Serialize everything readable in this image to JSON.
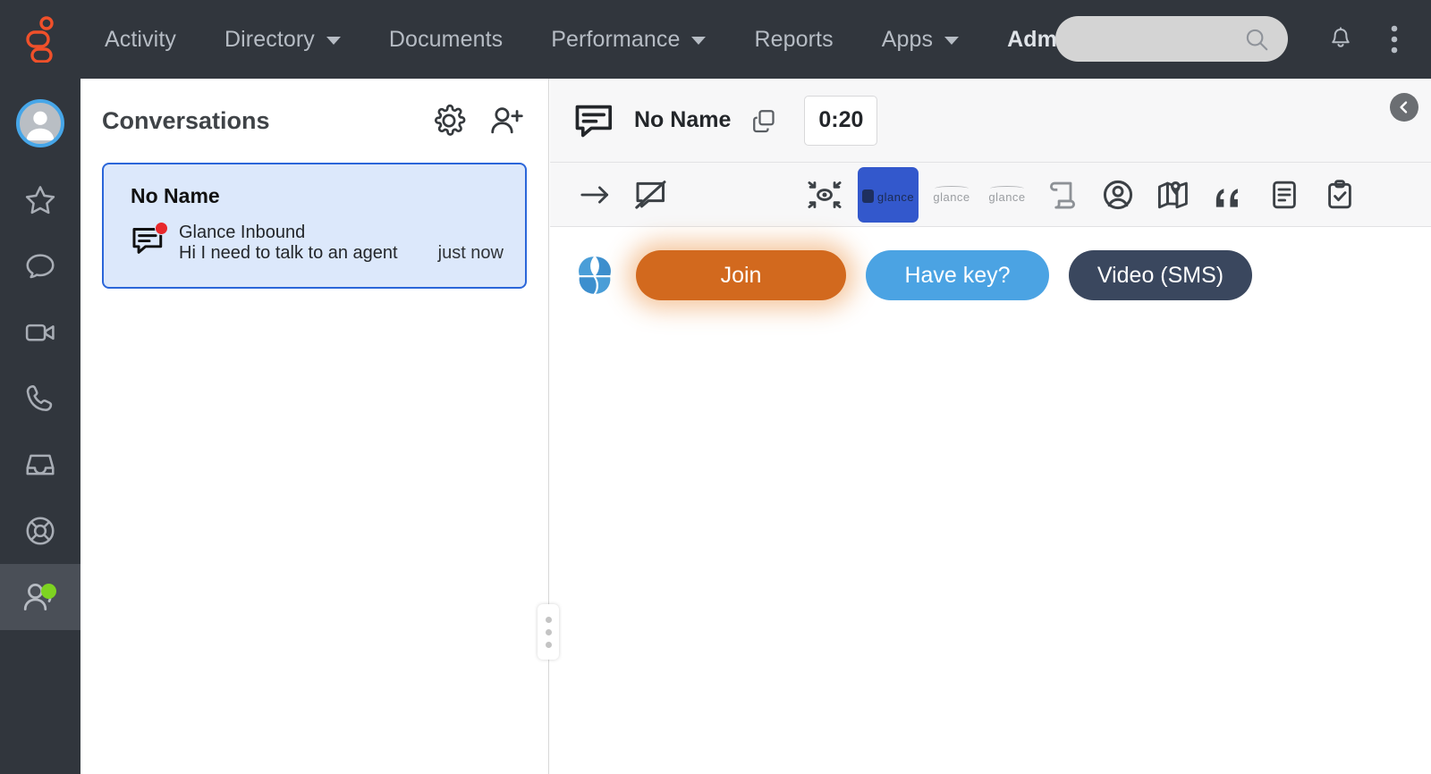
{
  "brand": {
    "logo_name": "glance-logo",
    "accent": "#f0502a"
  },
  "topnav": {
    "items": [
      {
        "label": "Activity",
        "has_caret": false
      },
      {
        "label": "Directory",
        "has_caret": true
      },
      {
        "label": "Documents",
        "has_caret": false
      },
      {
        "label": "Performance",
        "has_caret": true
      },
      {
        "label": "Reports",
        "has_caret": false
      },
      {
        "label": "Apps",
        "has_caret": true
      },
      {
        "label": "Admi",
        "has_caret": false
      }
    ],
    "search": {
      "value": "",
      "placeholder": ""
    },
    "bell_icon": "notification-bell-icon",
    "kebab_icon": "more-vertical-icon",
    "background": "#31363d"
  },
  "rail": {
    "items": [
      {
        "icon": "avatar-icon",
        "active": false
      },
      {
        "icon": "star-icon",
        "active": false
      },
      {
        "icon": "chat-bubble-icon",
        "active": false
      },
      {
        "icon": "video-camera-icon",
        "active": false
      },
      {
        "icon": "phone-icon",
        "active": false
      },
      {
        "icon": "inbox-tray-icon",
        "active": false
      },
      {
        "icon": "life-ring-icon",
        "active": false
      },
      {
        "icon": "agent-presence-icon",
        "active": true,
        "status": "online",
        "status_color": "#7ed321"
      }
    ]
  },
  "conversations": {
    "title": "Conversations",
    "settings_icon": "gear-icon",
    "add_person_icon": "add-person-icon",
    "items": [
      {
        "name": "No Name",
        "source": "Glance Inbound",
        "preview": "Hi I need to talk to an agent",
        "time": "just now",
        "unread": true,
        "selected": true
      }
    ]
  },
  "main": {
    "header": {
      "chat_icon": "chat-message-icon",
      "title": "No Name",
      "copy_icon": "copy-icon",
      "timer": "0:20"
    },
    "collapse_icon": "chevron-left-circle-icon",
    "toolbar": [
      {
        "icon": "arrow-right-icon",
        "active": false
      },
      {
        "icon": "chat-disabled-icon",
        "active": false
      },
      {
        "icon": "eye-focus-icon",
        "active": false
      },
      {
        "icon": "glance-session-icon",
        "label": "glance",
        "active": true
      },
      {
        "icon": "glance-logo-icon",
        "label": "glance",
        "active": false
      },
      {
        "icon": "glance-logo-alt-icon",
        "label": "glance",
        "active": false
      },
      {
        "icon": "scroll-script-icon",
        "active": false
      },
      {
        "icon": "user-circle-icon",
        "active": false
      },
      {
        "icon": "map-pin-icon",
        "active": false
      },
      {
        "icon": "quote-marks-icon",
        "active": false
      },
      {
        "icon": "document-lines-icon",
        "active": false
      },
      {
        "icon": "clipboard-check-icon",
        "active": false
      }
    ],
    "actions": {
      "glance_mark_icon": "glance-circle-icon",
      "buttons": [
        {
          "label": "Join",
          "style": "primary",
          "color": "#d2691e",
          "highlighted": true
        },
        {
          "label": "Have key?",
          "style": "secondary",
          "color": "#4ba3e3",
          "highlighted": false
        },
        {
          "label": "Video (SMS)",
          "style": "dark",
          "color": "#3a475e",
          "highlighted": false
        }
      ]
    }
  },
  "resize_handle": {
    "name": "panel-resize-handle"
  }
}
